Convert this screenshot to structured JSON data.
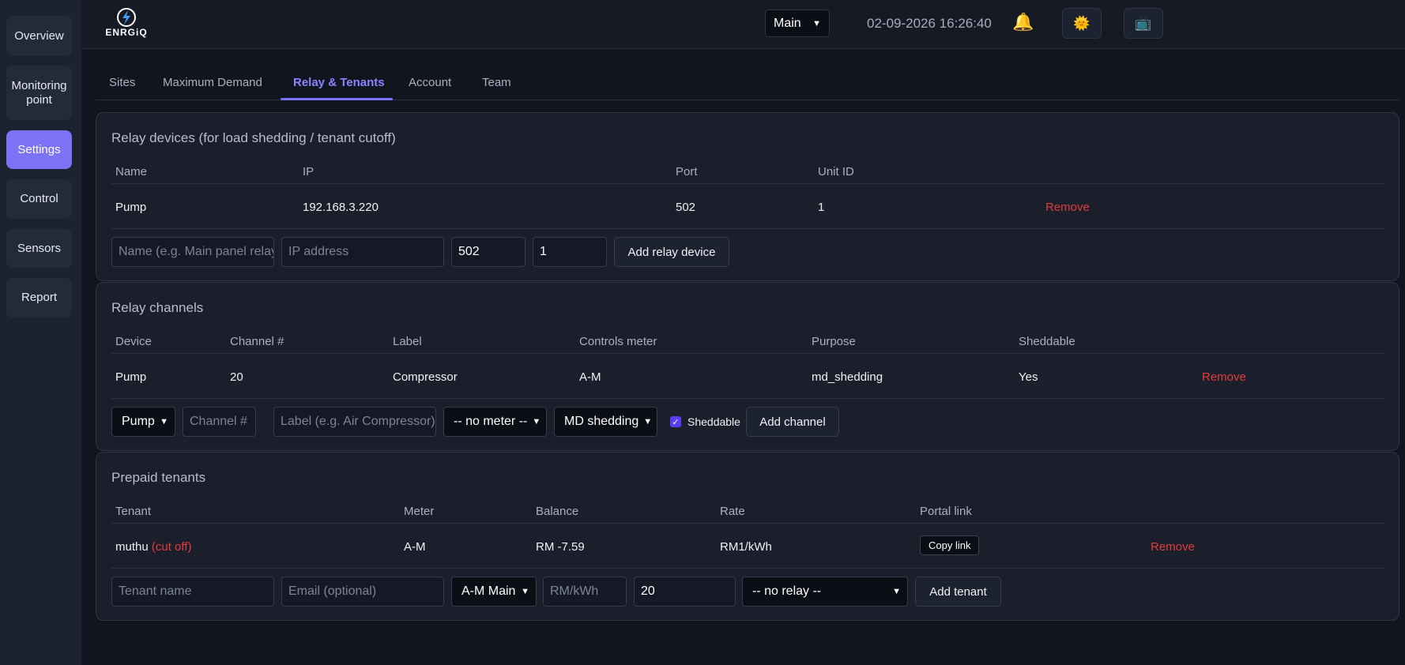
{
  "sidebar": {
    "items": [
      {
        "label": "Overview"
      },
      {
        "label": "Monitoring point"
      },
      {
        "label": "Settings"
      },
      {
        "label": "Control"
      },
      {
        "label": "Sensors"
      },
      {
        "label": "Report"
      }
    ]
  },
  "header": {
    "logo_text": "ENRGiQ",
    "site_select": "Main",
    "datetime": "02-09-2026 16:26:40"
  },
  "tabs": [
    {
      "label": "Sites"
    },
    {
      "label": "Maximum Demand"
    },
    {
      "label": "Relay & Tenants"
    },
    {
      "label": "Account"
    },
    {
      "label": "Team"
    }
  ],
  "relay_devices": {
    "title": "Relay devices (for load shedding / tenant cutoff)",
    "columns": [
      "Name",
      "IP",
      "Port",
      "Unit ID"
    ],
    "rows": [
      {
        "name": "Pump",
        "ip": "192.168.3.220",
        "port": "502",
        "unit_id": "1",
        "action": "Remove"
      }
    ],
    "form": {
      "name_placeholder": "Name (e.g. Main panel relay)",
      "ip_placeholder": "IP address",
      "port_value": "502",
      "unit_id_value": "1",
      "add_label": "Add relay device"
    }
  },
  "relay_channels": {
    "title": "Relay channels",
    "columns": [
      "Device",
      "Channel #",
      "Label",
      "Controls meter",
      "Purpose",
      "Sheddable"
    ],
    "rows": [
      {
        "device": "Pump",
        "channel": "20",
        "label": "Compressor",
        "meter": "A-M",
        "purpose": "md_shedding",
        "sheddable": "Yes",
        "action": "Remove"
      }
    ],
    "form": {
      "device_value": "Pump",
      "channel_placeholder": "Channel #",
      "label_placeholder": "Label (e.g. Air Compressor)",
      "meter_value": "-- no meter --",
      "purpose_value": "MD shedding",
      "sheddable_label": "Sheddable",
      "add_label": "Add channel"
    }
  },
  "prepaid_tenants": {
    "title": "Prepaid tenants",
    "columns": [
      "Tenant",
      "Meter",
      "Balance",
      "Rate",
      "Portal link"
    ],
    "rows": [
      {
        "tenant": "muthu",
        "status": "(cut off)",
        "meter": "A-M",
        "balance": "RM -7.59",
        "rate": "RM1/kWh",
        "link_label": "Copy link",
        "action": "Remove"
      }
    ],
    "form": {
      "name_placeholder": "Tenant name",
      "email_placeholder": "Email (optional)",
      "meter_value": "A-M Main",
      "rate_placeholder": "RM/kWh",
      "value": "20",
      "relay_value": "-- no relay --",
      "add_label": "Add tenant"
    }
  },
  "colors": {
    "accent": "#7b72f5",
    "danger": "#e23b3b",
    "background": "#111520",
    "card": "#1a1f2b"
  }
}
